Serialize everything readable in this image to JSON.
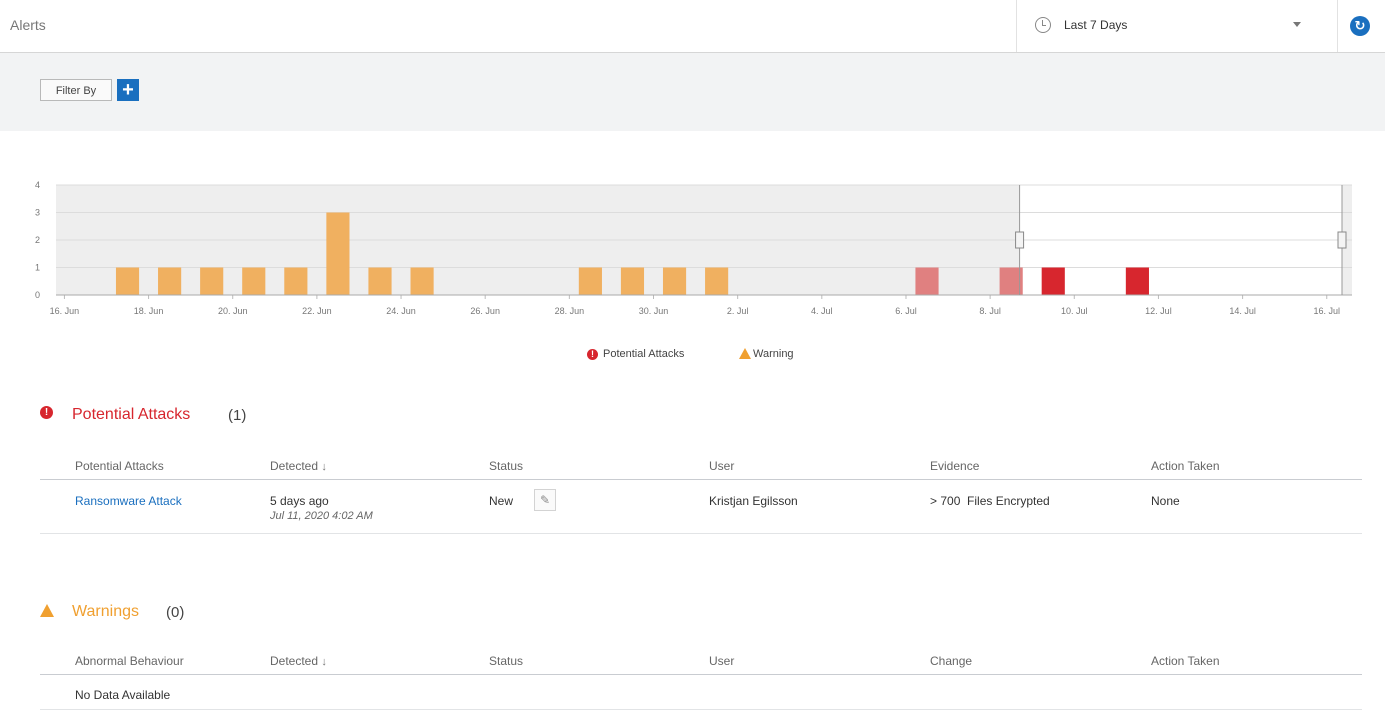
{
  "header": {
    "title": "Alerts",
    "time_range": "Last 7 Days"
  },
  "icons": {
    "clock": "clock-icon",
    "caret": "chevron-down-icon",
    "refresh": "refresh-icon",
    "add": "plus-icon",
    "edit": "pencil-icon",
    "sort": "arrow-down-icon",
    "attack": "exclamation-circle-icon",
    "warning": "warning-triangle-icon"
  },
  "filter": {
    "label": "Filter By",
    "add_label": "+"
  },
  "colors": {
    "warning": "#f0b060",
    "attack_faded": "#e08080",
    "attack": "#d7262e",
    "accent": "#1a6fbf"
  },
  "chart_data": {
    "type": "bar",
    "y_ticks": [
      "0",
      "1",
      "2",
      "3",
      "4"
    ],
    "ylim": [
      0,
      4
    ],
    "x_ticks": [
      "16. Jun",
      "18. Jun",
      "20. Jun",
      "22. Jun",
      "24. Jun",
      "26. Jun",
      "28. Jun",
      "30. Jun",
      "2. Jul",
      "4. Jul",
      "6. Jul",
      "8. Jul",
      "10. Jul",
      "12. Jul",
      "14. Jul",
      "16. Jul"
    ],
    "series": [
      {
        "name": "Warning",
        "points": [
          {
            "x": "17. Jun",
            "y": 1
          },
          {
            "x": "18. Jun",
            "y": 1
          },
          {
            "x": "19. Jun",
            "y": 1
          },
          {
            "x": "20. Jun",
            "y": 1
          },
          {
            "x": "21. Jun",
            "y": 1
          },
          {
            "x": "22. Jun",
            "y": 3
          },
          {
            "x": "23. Jun",
            "y": 1
          },
          {
            "x": "24. Jun",
            "y": 1
          },
          {
            "x": "28. Jun",
            "y": 1
          },
          {
            "x": "29. Jun",
            "y": 1
          },
          {
            "x": "30. Jun",
            "y": 1
          },
          {
            "x": "1. Jul",
            "y": 1
          }
        ]
      },
      {
        "name": "Potential Attacks",
        "points": [
          {
            "x": "6. Jul",
            "y": 1
          },
          {
            "x": "8. Jul",
            "y": 1
          },
          {
            "x": "9. Jul",
            "y": 1
          },
          {
            "x": "11. Jul",
            "y": 1
          }
        ]
      }
    ],
    "legend": [
      "Potential Attacks",
      "Warning"
    ],
    "grid": true
  },
  "attacks": {
    "title": "Potential Attacks",
    "count": "(1)",
    "columns": [
      "Potential Attacks",
      "Detected",
      "Status",
      "User",
      "Evidence",
      "Action Taken"
    ],
    "rows": [
      {
        "name": "Ransomware Attack",
        "detected": "5 days ago",
        "detected_date": "Jul 11, 2020 4:02 AM",
        "status": "New",
        "user": "Kristjan Egilsson",
        "evidence": "> 700  Files Encrypted",
        "action": "None"
      }
    ]
  },
  "warnings": {
    "title": "Warnings",
    "count": "(0)",
    "columns": [
      "Abnormal Behaviour",
      "Detected",
      "Status",
      "User",
      "Change",
      "Action Taken"
    ],
    "empty": "No Data Available"
  }
}
